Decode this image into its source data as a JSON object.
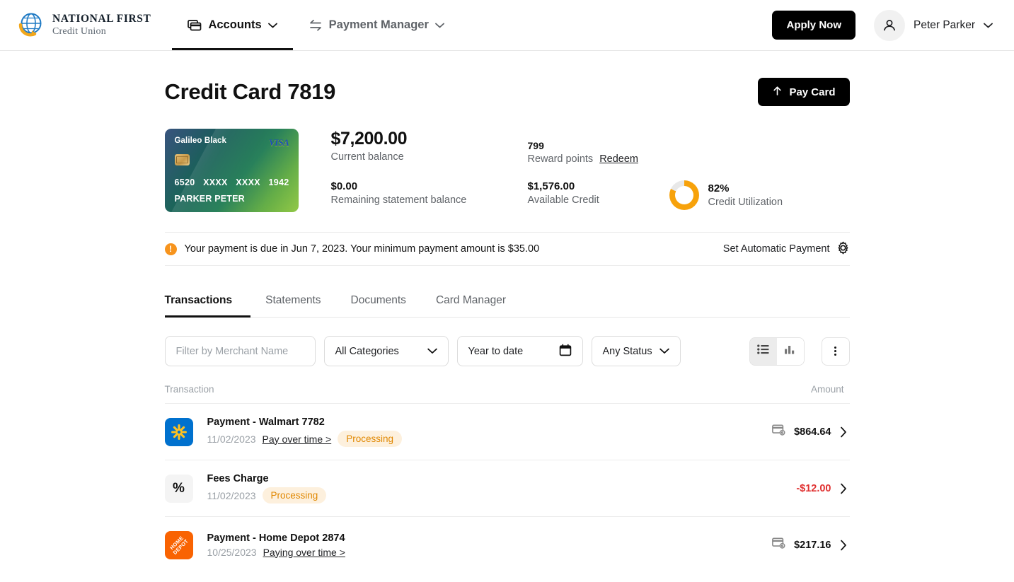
{
  "header": {
    "brand": {
      "line1": "NATIONAL FIRST",
      "line2": "Credit Union",
      "logo_icon": "globe-arrow-logo"
    },
    "nav": [
      {
        "label": "Accounts",
        "icon": "cards-icon",
        "active": true
      },
      {
        "label": "Payment Manager",
        "icon": "transfer-arrows-icon",
        "active": false
      }
    ],
    "apply_label": "Apply Now",
    "user_name": "Peter Parker",
    "user_icon": "person-icon",
    "chevron_icon": "chevron-down-icon"
  },
  "page": {
    "title": "Credit Card 7819",
    "pay_card_label": "Pay Card",
    "pay_card_icon": "arrow-up-icon"
  },
  "card": {
    "product_name": "Galileo Black",
    "network": "VISA",
    "number": [
      "6520",
      "XXXX",
      "XXXX",
      "1942"
    ],
    "holder": "PARKER PETER",
    "chip_icon": "chip-icon"
  },
  "stats": {
    "current_balance_value": "$7,200.00",
    "current_balance_label": "Current balance",
    "reward_points_value": "799",
    "reward_points_label": "Reward points",
    "redeem_label": "Redeem",
    "remaining_statement_value": "$0.00",
    "remaining_statement_label": "Remaining statement balance",
    "available_credit_value": "$1,576.00",
    "available_credit_label": "Available Credit",
    "utilization_value": "82%",
    "utilization_label": "Credit Utilization",
    "utilization_percent": 82,
    "utilization_color": "#f7a20b",
    "utilization_track_color": "#e8e8e8"
  },
  "alert": {
    "icon": "alert-exclamation-icon",
    "message": "Your payment is due in Jun 7, 2023. Your minimum payment amount is $35.00",
    "action_label": "Set Automatic Payment",
    "action_icon": "gear-icon",
    "accent_color": "#f7941d"
  },
  "tabs": [
    {
      "label": "Transactions",
      "active": true
    },
    {
      "label": "Statements",
      "active": false
    },
    {
      "label": "Documents",
      "active": false
    },
    {
      "label": "Card Manager",
      "active": false
    }
  ],
  "filters": {
    "merchant_placeholder": "Filter by Merchant Name",
    "merchant_value": "",
    "category_value": "All Categories",
    "date_value": "Year to date",
    "date_icon": "calendar-icon",
    "status_value": "Any Status",
    "list_view_icon": "list-icon",
    "chart_view_icon": "bar-chart-icon",
    "more_icon": "kebab-menu-icon",
    "list_view_selected": true
  },
  "table": {
    "columns": [
      "Transaction",
      "Amount"
    ],
    "rows": [
      {
        "logo": "walmart-logo",
        "name": "Payment - Walmart 7782",
        "date": "11/02/2023",
        "link": "Pay over time >",
        "badge": "Processing",
        "amount": "$864.64",
        "negative": false,
        "amount_icon": "credit-card-icon",
        "chevron_icon": "chevron-right-icon"
      },
      {
        "logo": "percent-icon",
        "name": "Fees Charge",
        "date": "11/02/2023",
        "link": "",
        "badge": "Processing",
        "amount": "-$12.00",
        "negative": true,
        "amount_icon": "",
        "chevron_icon": "chevron-right-icon"
      },
      {
        "logo": "home-depot-logo",
        "name": "Payment - Home Depot 2874",
        "date": "10/25/2023",
        "link": "Paying over time >",
        "badge": "",
        "amount": "$217.16",
        "negative": false,
        "amount_icon": "credit-card-icon",
        "chevron_icon": "chevron-right-icon"
      }
    ]
  }
}
